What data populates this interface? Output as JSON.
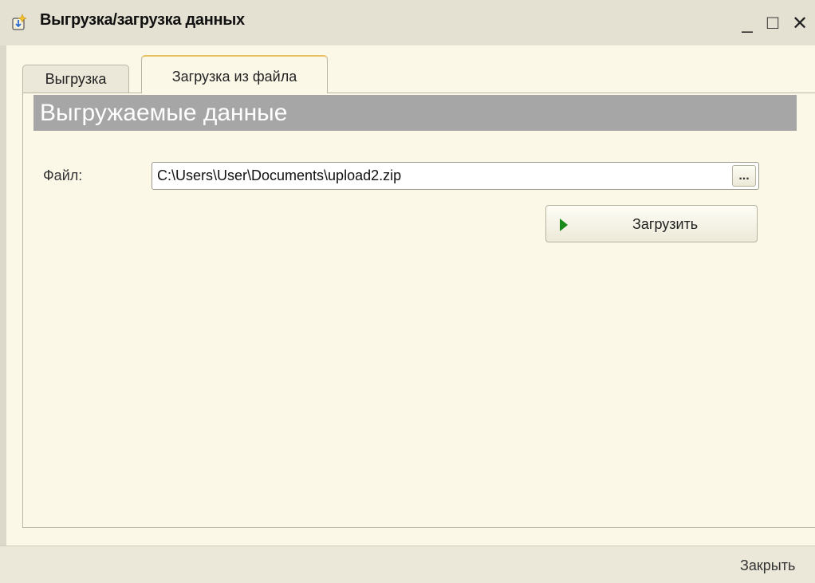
{
  "window": {
    "title": "Выгрузка/загрузка данных",
    "title_icon": "data-exchange-icon",
    "controls": {
      "minimize": "_",
      "maximize": "□",
      "close": "✕"
    }
  },
  "tabs": [
    {
      "label": "Выгрузка",
      "active": false
    },
    {
      "label": "Загрузка из файла",
      "active": true
    }
  ],
  "section": {
    "header": "Выгружаемые данные"
  },
  "file": {
    "label": "Файл:",
    "value": "C:\\Users\\User\\Documents\\upload2.zip",
    "browse_label": "..."
  },
  "actions": {
    "load_label": "Загрузить",
    "load_icon": "play-icon",
    "close_label": "Закрыть"
  },
  "colors": {
    "background": "#fbf8e8",
    "section_header": "#a6a6a6",
    "active_tab_accent": "#e8c060",
    "play_icon": "#1a8a1a"
  }
}
